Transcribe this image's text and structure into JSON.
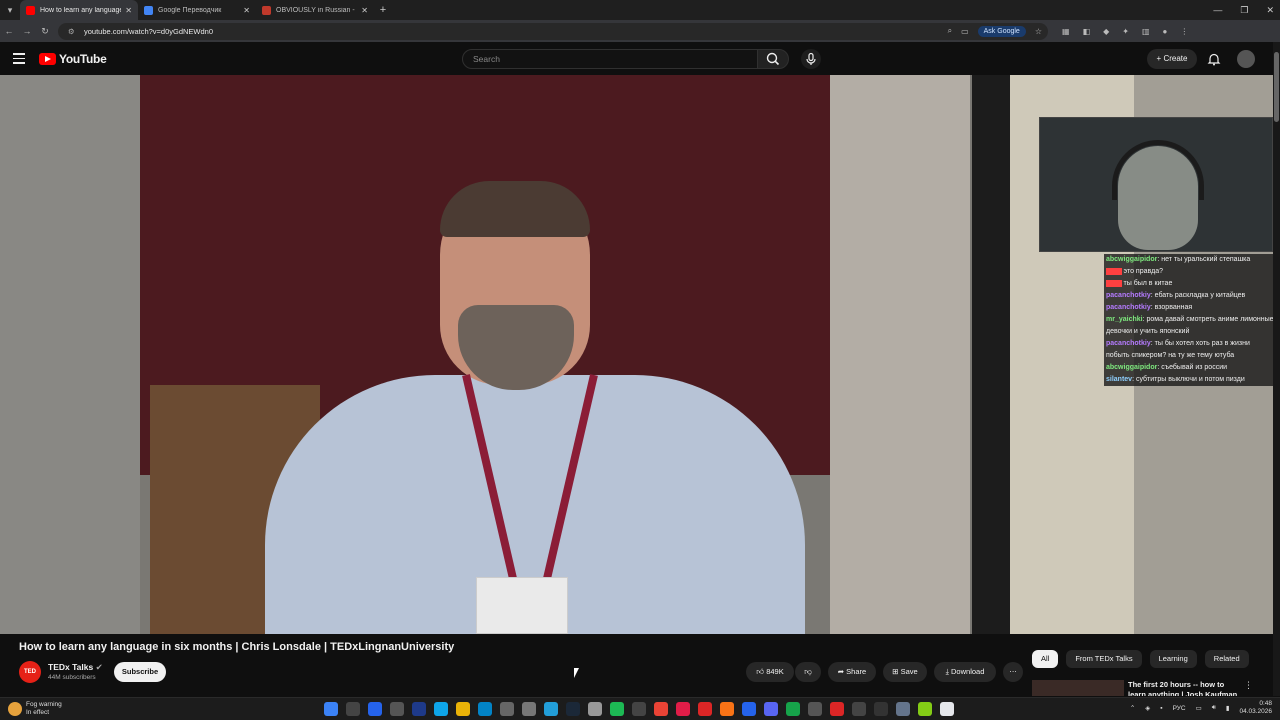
{
  "browser": {
    "tabs": [
      {
        "title": "How to learn any language in six months | Chris Lonsdale | TEDxLingnanUniversity",
        "color": "#ff0000",
        "active": true
      },
      {
        "title": "Google Переводчик",
        "color": "#4285f4",
        "active": false
      },
      {
        "title": "OBVIOUSLY in Russian - Cambridge Dictionary",
        "color": "#c0392b",
        "active": false
      }
    ],
    "url": "youtube.com/watch?v=d0yGdNEWdn0",
    "ask_google": "Ask Google"
  },
  "masthead": {
    "logo_text": "YouTube",
    "search_placeholder": "Search",
    "create_label": "Create"
  },
  "overlay": {
    "chat": [
      {
        "nick": "abcwiggaipidor",
        "nick_color": "#7ee87e",
        "text": "нет ты уральский степашка"
      },
      {
        "nick": "",
        "nick_color": "#ff4040",
        "text": "это правда?"
      },
      {
        "nick": "",
        "nick_color": "#ff4040",
        "text": "ты был в китае"
      },
      {
        "nick": "pacanchotkiy",
        "nick_color": "#b57bff",
        "text": "ебать раскладка у китайцев"
      },
      {
        "nick": "pacanchotkiy",
        "nick_color": "#b57bff",
        "text": "взорванная"
      },
      {
        "nick": "mr_yaichki",
        "nick_color": "#7ee87e",
        "text": "рома давай смотреть аниме лимонные девочки и учить японский"
      },
      {
        "nick": "pacanchotkiy",
        "nick_color": "#b57bff",
        "text": "ты бы хотел хоть раз в жизни побыть спикером? на ту же тему ютуба"
      },
      {
        "nick": "abcwiggaipidor",
        "nick_color": "#7ee87e",
        "text": "съебывай из россии"
      },
      {
        "nick": "silantev",
        "nick_color": "#8fd0ff",
        "text": "субтитры выключи и потом пизди"
      }
    ]
  },
  "video": {
    "title": "How to learn any language in six months | Chris Lonsdale | TEDxLingnanUniversity",
    "channel": "TEDx Talks",
    "channel_avatar_text": "TED",
    "subscribers": "44M subscribers",
    "subscribe_label": "Subscribe",
    "likes": "849K",
    "share_label": "Share",
    "save_label": "Save",
    "download_label": "Download"
  },
  "sidebar": {
    "chips": [
      "All",
      "From TEDx Talks",
      "Learning",
      "Related"
    ],
    "recommendation_title": "The first 20 hours -- how to learn anything | Josh Kaufman"
  },
  "taskbar": {
    "weather_title": "Fog warning",
    "weather_sub": "In effect",
    "lang": "РУС",
    "time": "0:48",
    "date": "04.03.2026"
  }
}
